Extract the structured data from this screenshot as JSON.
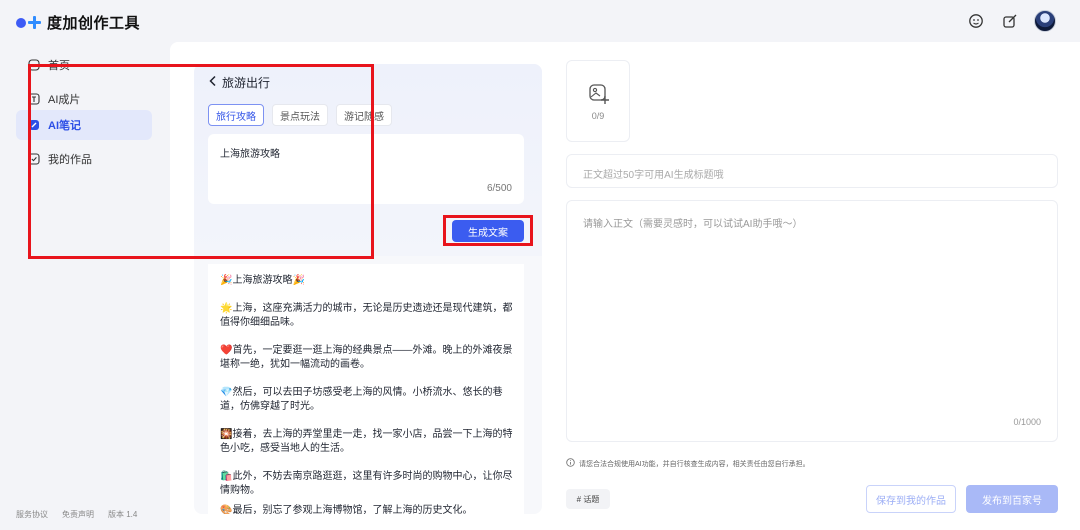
{
  "app": {
    "name": "度加创作工具"
  },
  "sidebar": {
    "items": [
      {
        "label": "首页",
        "icon": "home-icon"
      },
      {
        "label": "AI成片",
        "icon": "ai-video-icon"
      },
      {
        "label": "AI笔记",
        "icon": "ai-note-icon",
        "active": true
      },
      {
        "label": "我的作品",
        "icon": "my-works-icon"
      }
    ],
    "footer": {
      "terms": "服务协议",
      "disclaimer": "免责声明",
      "version": "版本 1.4"
    }
  },
  "generator": {
    "back_label": "旅游出行",
    "tabs": [
      {
        "label": "旅行攻略",
        "active": true
      },
      {
        "label": "景点玩法"
      },
      {
        "label": "游记随感"
      }
    ],
    "prompt_value": "上海旅游攻略",
    "prompt_count": "6/500",
    "generate_label": "生成文案"
  },
  "result": {
    "paragraphs": [
      "🎉上海旅游攻略🎉",
      "🌟上海，这座充满活力的城市，无论是历史遗迹还是现代建筑，都值得你细细品味。",
      "❤️首先，一定要逛一逛上海的经典景点——外滩。晚上的外滩夜景堪称一绝，犹如一幅流动的画卷。",
      "💎然后，可以去田子坊感受老上海的风情。小桥流水、悠长的巷道，仿佛穿越了时光。",
      "🎇接着，去上海的弄堂里走一走，找一家小店，品尝一下上海的特色小吃，感受当地人的生活。",
      "🛍️此外，不妨去南京路逛逛，这里有许多时尚的购物中心，让你尽情购物。",
      "🎨最后，别忘了参观上海博物馆，了解上海的历史文化。"
    ]
  },
  "editor": {
    "image_count": "0/9",
    "title_placeholder": "正文超过50字可用AI生成标题哦",
    "body_placeholder": "请输入正文（需要灵感时，可以试试AI助手哦～）",
    "body_count": "0/1000",
    "notice": "请您合法合规使用AI功能，并自行核查生成内容，相关责任由您自行承担。",
    "topic_label": "# 话题",
    "save_label": "保存到我的作品",
    "publish_label": "发布到百家号"
  },
  "colors": {
    "accent": "#3b5cf0",
    "highlight": "#e8141c"
  }
}
